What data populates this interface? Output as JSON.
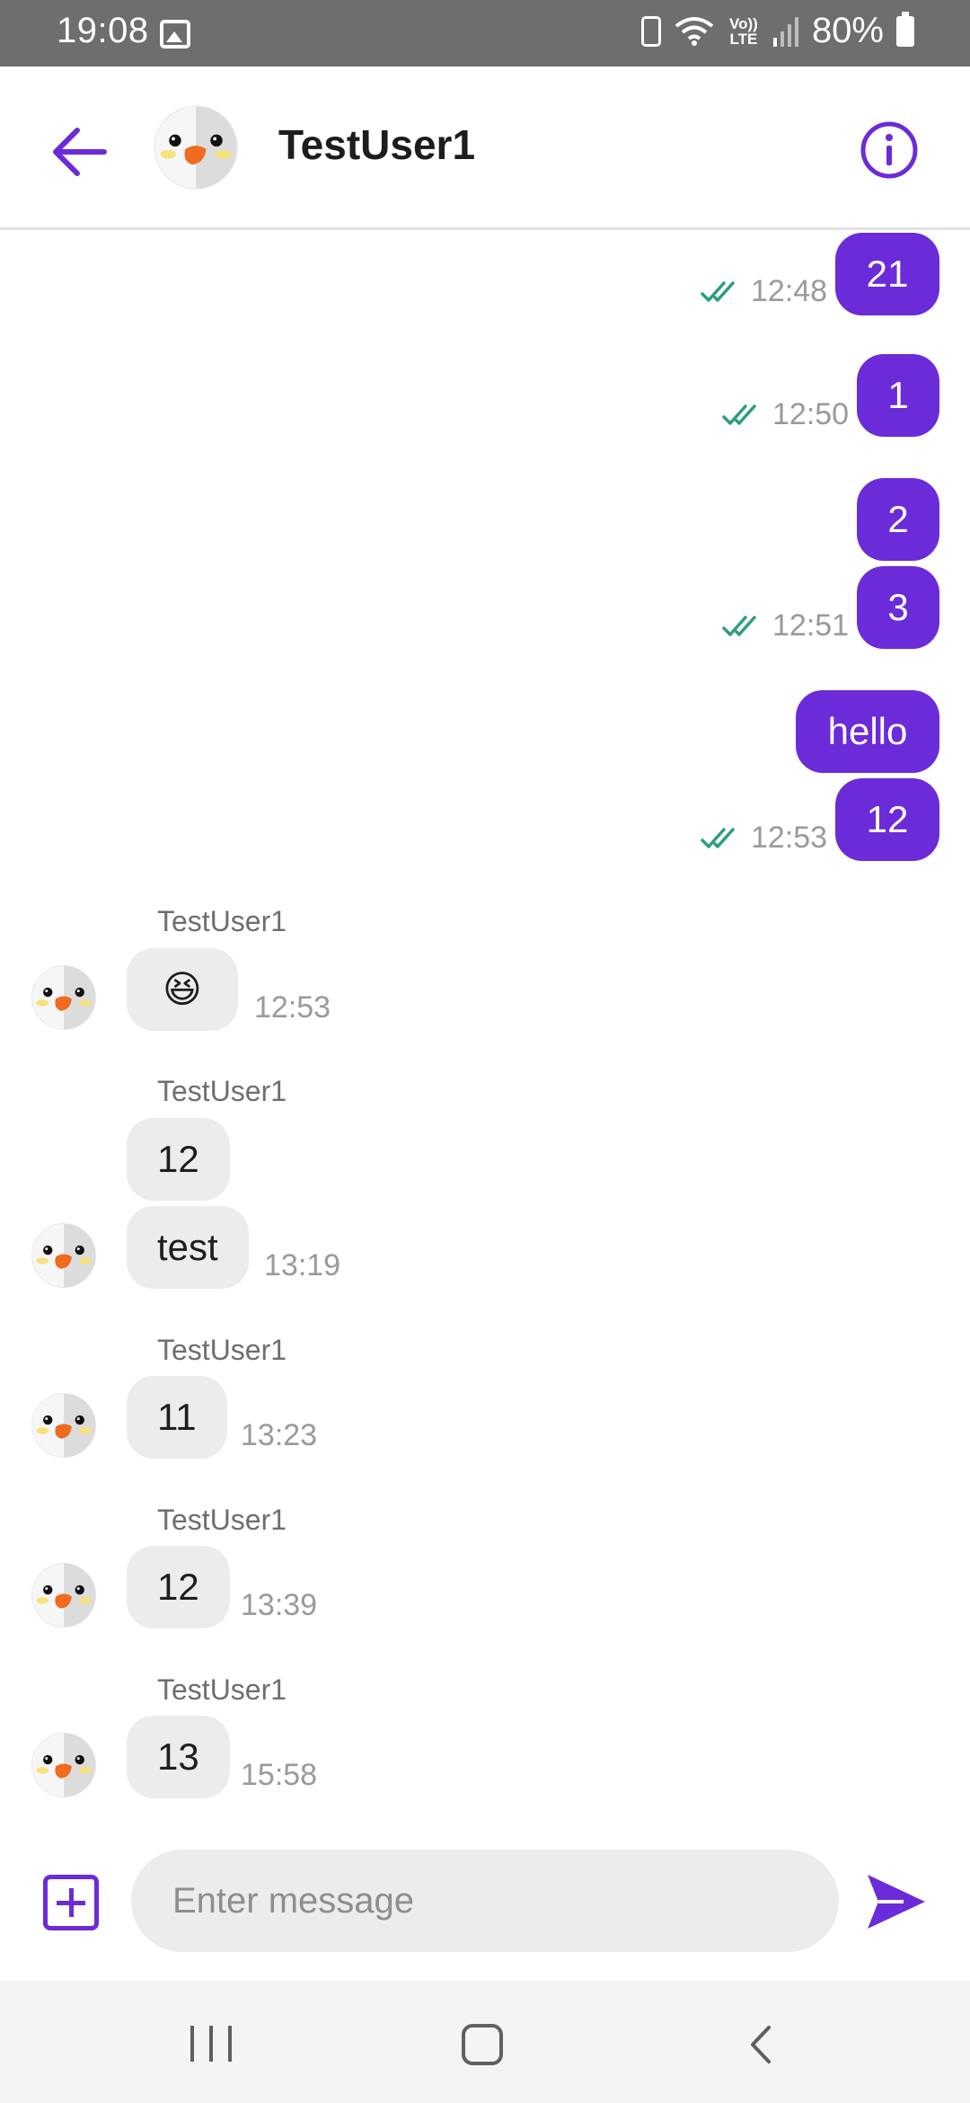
{
  "status_bar": {
    "time": "19:08",
    "battery_percent": "80%",
    "volte_label": "Vo)) LTE",
    "icons": [
      "gallery-icon",
      "sync-icon",
      "wifi-icon",
      "volte-icon",
      "signal-icon",
      "battery-icon"
    ]
  },
  "header": {
    "title": "TestUser1",
    "back_icon": "arrow-left-icon",
    "info_icon": "info-icon"
  },
  "colors": {
    "accent": "#6c2bd9",
    "outgoing_bubble": "#6c2bd9",
    "incoming_bubble": "#ececec",
    "read_check": "#2e9e7a",
    "timestamp": "#9a9a9a"
  },
  "outgoing": [
    {
      "text": "21",
      "time": "12:48"
    },
    {
      "text": "1",
      "time": "12:50"
    },
    {
      "text": "2"
    },
    {
      "text": "3",
      "time": "12:51"
    },
    {
      "text": "hello"
    },
    {
      "text": "12",
      "time": "12:53"
    }
  ],
  "incoming": [
    {
      "sender": "TestUser1",
      "messages": [
        "😆"
      ],
      "time": "12:53"
    },
    {
      "sender": "TestUser1",
      "messages": [
        "12",
        "test"
      ],
      "time": "13:19"
    },
    {
      "sender": "TestUser1",
      "messages": [
        "11"
      ],
      "time": "13:23"
    },
    {
      "sender": "TestUser1",
      "messages": [
        "12"
      ],
      "time": "13:39"
    },
    {
      "sender": "TestUser1",
      "messages": [
        "13"
      ],
      "time": "15:58"
    }
  ],
  "composer": {
    "placeholder": "Enter message",
    "value": "",
    "attach_icon": "plus-square-icon",
    "send_icon": "send-icon"
  },
  "nav_bar": {
    "icons": [
      "recents-icon",
      "home-icon",
      "back-icon"
    ]
  }
}
